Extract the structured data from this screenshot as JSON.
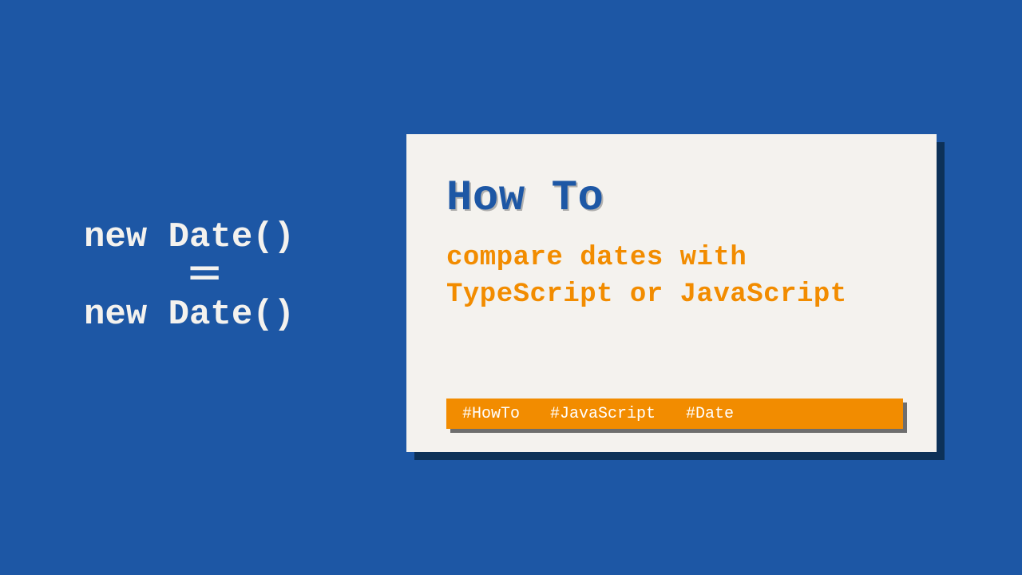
{
  "left": {
    "line1": "new Date()",
    "equals": "=",
    "line2": "new Date()"
  },
  "card": {
    "title": "How To",
    "subtitle": "compare dates with TypeScript or JavaScript",
    "tags": [
      "#HowTo",
      "#JavaScript",
      "#Date"
    ]
  }
}
